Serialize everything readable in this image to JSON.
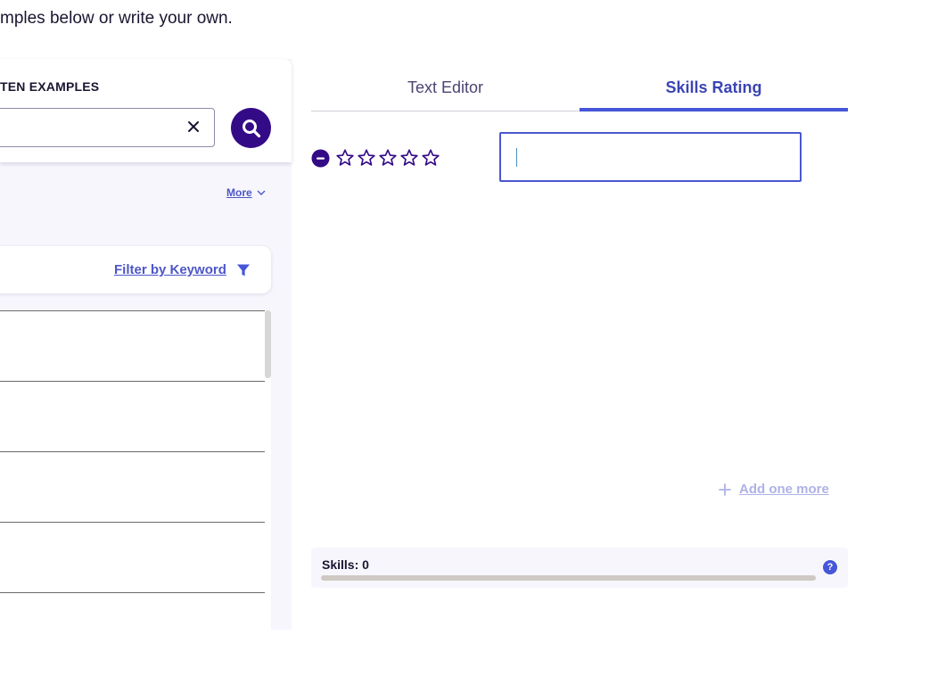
{
  "intro_text": "mples below or write your own.",
  "examples": {
    "title": "TEN EXAMPLES",
    "search": {
      "value": "",
      "placeholder": ""
    },
    "more_label": "More",
    "filter_label": "Filter by Keyword",
    "results": [
      {},
      {},
      {},
      {}
    ]
  },
  "tabs": [
    {
      "label": "Text Editor",
      "active": false
    },
    {
      "label": "Skills Rating",
      "active": true
    }
  ],
  "skill_row": {
    "rating": 0,
    "max_rating": 5,
    "value": ""
  },
  "add_more_label": "Add one more",
  "skills_summary": {
    "label": "Skills: 0",
    "progress": 0,
    "help_icon": "?"
  },
  "colors": {
    "primary": "#340b87",
    "accent": "#4556d8",
    "link": "#4d57c7"
  }
}
